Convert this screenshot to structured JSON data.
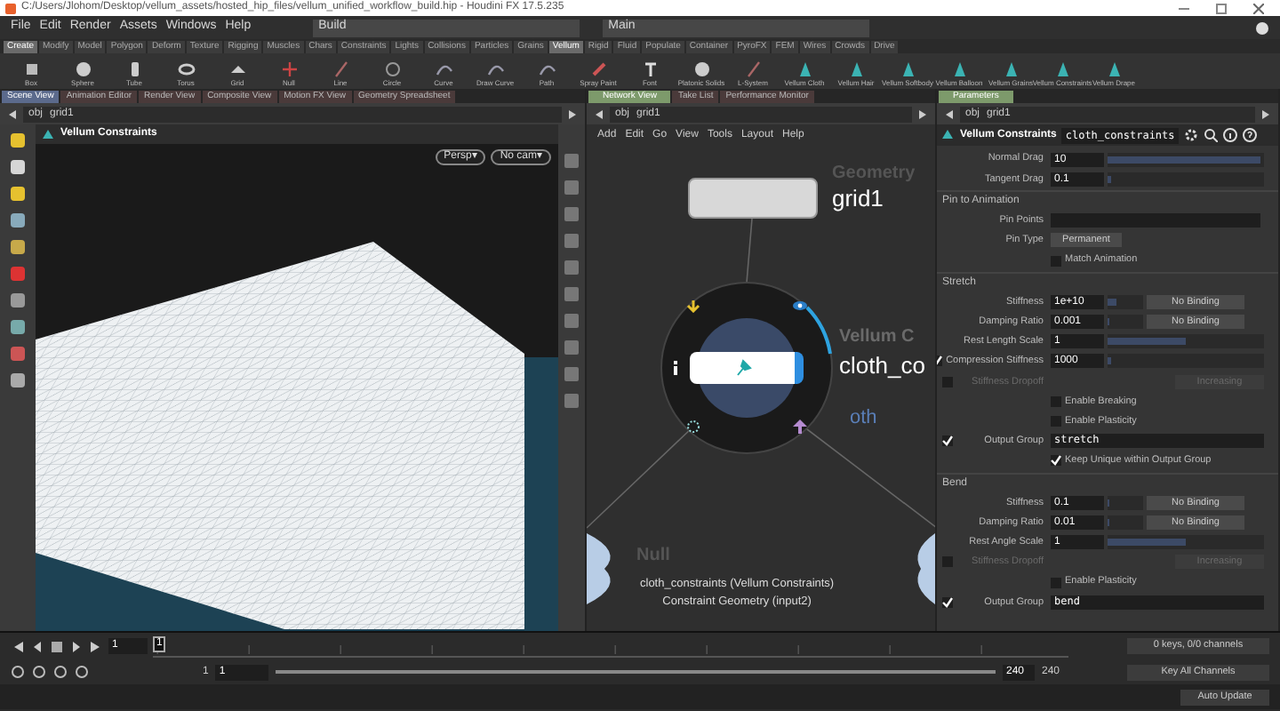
{
  "window": {
    "title": "C:/Users/Jlohom/Desktop/vellum_assets/hosted_hip_files/vellum_unified_workflow_build.hip - Houdini FX 17.5.235"
  },
  "menu": [
    "File",
    "Edit",
    "Render",
    "Assets",
    "Windows",
    "Help"
  ],
  "desktops": [
    "Build",
    "Main"
  ],
  "shelf_tabs": [
    {
      "label": "Create",
      "selected": true
    },
    {
      "label": "Modify",
      "selected": false
    },
    {
      "label": "Model",
      "selected": false
    },
    {
      "label": "Polygon",
      "selected": false
    },
    {
      "label": "Deform",
      "selected": false
    },
    {
      "label": "Texture",
      "selected": false
    },
    {
      "label": "Rigging",
      "selected": false
    },
    {
      "label": "Muscles",
      "selected": false
    },
    {
      "label": "Chars",
      "selected": false
    },
    {
      "label": "Constraints",
      "selected": false
    },
    {
      "label": "Lights",
      "selected": false
    },
    {
      "label": "Collisions",
      "selected": false
    },
    {
      "label": "Particles",
      "selected": false
    },
    {
      "label": "Grains",
      "selected": false
    },
    {
      "label": "Vellum",
      "selected": true
    },
    {
      "label": "Rigid",
      "selected": false
    },
    {
      "label": "Fluid",
      "selected": false
    },
    {
      "label": "Populate",
      "selected": false
    },
    {
      "label": "Container",
      "selected": false
    },
    {
      "label": "PyroFX",
      "selected": false
    },
    {
      "label": "FEM",
      "selected": false
    },
    {
      "label": "Wires",
      "selected": false
    },
    {
      "label": "Crowds",
      "selected": false
    },
    {
      "label": "Drive",
      "selected": false
    }
  ],
  "shelf_tools": [
    {
      "label": "Box",
      "kind": "box"
    },
    {
      "label": "Sphere",
      "kind": "sphere"
    },
    {
      "label": "Tube",
      "kind": "tube"
    },
    {
      "label": "Torus",
      "kind": "torus"
    },
    {
      "label": "Grid",
      "kind": "grid"
    },
    {
      "label": "Null",
      "kind": "null"
    },
    {
      "label": "Line",
      "kind": "line"
    },
    {
      "label": "Circle",
      "kind": "circle"
    },
    {
      "label": "Curve",
      "kind": "curve"
    },
    {
      "label": "Draw Curve",
      "kind": "curve"
    },
    {
      "label": "Path",
      "kind": "curve"
    },
    {
      "label": "Spray Paint",
      "kind": "paint"
    },
    {
      "label": "Font",
      "kind": "font"
    },
    {
      "label": "Platonic Solids",
      "kind": "sphere"
    },
    {
      "label": "L-System",
      "kind": "line"
    },
    {
      "label": "Vellum Cloth",
      "kind": "vellum"
    },
    {
      "label": "Vellum Hair",
      "kind": "vellum"
    },
    {
      "label": "Vellum Softbody",
      "kind": "vellum"
    },
    {
      "label": "Vellum Balloon",
      "kind": "vellum"
    },
    {
      "label": "Vellum Grains",
      "kind": "vellum"
    },
    {
      "label": "Vellum Constraints",
      "kind": "vellum"
    },
    {
      "label": "Vellum Drape",
      "kind": "vellum"
    }
  ],
  "panes": [
    {
      "tabs": [
        {
          "label": "Scene View",
          "selected": true
        },
        {
          "label": "Animation Editor",
          "selected": false
        },
        {
          "label": "Render View",
          "selected": false
        },
        {
          "label": "Composite View",
          "selected": false
        },
        {
          "label": "Motion FX View",
          "selected": false
        },
        {
          "label": "Geometry Spreadsheet",
          "selected": false
        }
      ],
      "path": [
        "obj",
        "grid1"
      ]
    },
    {
      "tabs": [
        {
          "label": "Network View",
          "selected": true
        },
        {
          "label": "Take List",
          "selected": false
        },
        {
          "label": "Performance Monitor",
          "selected": false
        }
      ],
      "path": [
        "obj",
        "grid1"
      ]
    },
    {
      "tabs": [
        {
          "label": "Parameters",
          "selected": true
        }
      ],
      "path": [
        "obj",
        "grid1"
      ]
    }
  ],
  "viewport": {
    "title": "Vellum Constraints",
    "buttons": [
      "Persp▾",
      "No cam▾"
    ]
  },
  "network": {
    "menu": [
      "Add",
      "Edit",
      "Go",
      "View",
      "Tools",
      "Layout",
      "Help"
    ],
    "nodes": [
      {
        "type_label": "Geometry",
        "name": "grid1"
      },
      {
        "type_label": "Vellum C",
        "name": "cloth_co",
        "sublabel": "oth"
      },
      {
        "type_label": "Null"
      }
    ],
    "tooltip": [
      "cloth_constraints (Vellum Constraints)",
      "Constraint Geometry (input2)"
    ]
  },
  "parameters": {
    "node_type": "Vellum Constraints",
    "node_name": "cloth_constraints",
    "rows": [
      {
        "kind": "field",
        "label": "Normal Drag",
        "value": "10",
        "level": 0.98
      },
      {
        "kind": "field",
        "label": "Tangent Drag",
        "value": "0.1",
        "level": 0.02
      },
      {
        "kind": "section",
        "label": "Pin to Animation"
      },
      {
        "kind": "input",
        "label": "Pin Points"
      },
      {
        "kind": "menu",
        "label": "Pin Type",
        "value": "Permanent"
      },
      {
        "kind": "toggle",
        "label": "Match Animation",
        "checked": false
      },
      {
        "kind": "section",
        "label": "Stretch"
      },
      {
        "kind": "field",
        "label": "Stiffness",
        "value": "1e+10",
        "level": 0.25,
        "binding": "No Binding"
      },
      {
        "kind": "field",
        "label": "Damping Ratio",
        "value": "0.001",
        "level": 0.01,
        "binding": "No Binding"
      },
      {
        "kind": "field",
        "label": "Rest Length Scale",
        "value": "1",
        "level": 0.5
      },
      {
        "kind": "field",
        "label": "Compression Stiffness",
        "value": "1000",
        "level": 0.02,
        "checked": true
      },
      {
        "kind": "disabled",
        "label": "Stiffness Dropoff",
        "value": "Increasing",
        "checked": false
      },
      {
        "kind": "toggle",
        "label": "Enable Breaking",
        "checked": false
      },
      {
        "kind": "toggle",
        "label": "Enable Plasticity",
        "checked": false
      },
      {
        "kind": "text",
        "label": "Output Group",
        "value": "stretch",
        "checked": true
      },
      {
        "kind": "toggle",
        "label": "Keep Unique within Output Group",
        "checked": true
      },
      {
        "kind": "section",
        "label": "Bend"
      },
      {
        "kind": "field",
        "label": "Stiffness",
        "value": "0.1",
        "level": 0.02,
        "binding": "No Binding"
      },
      {
        "kind": "field",
        "label": "Damping Ratio",
        "value": "0.01",
        "level": 0.01,
        "binding": "No Binding"
      },
      {
        "kind": "field",
        "label": "Rest Angle Scale",
        "value": "1",
        "level": 0.5
      },
      {
        "kind": "disabled",
        "label": "Stiffness Dropoff",
        "value": "Increasing",
        "checked": false
      },
      {
        "kind": "toggle",
        "label": "Enable Plasticity",
        "checked": false
      },
      {
        "kind": "text",
        "label": "Output Group",
        "value": "bend",
        "checked": true
      }
    ]
  },
  "timeline": {
    "frame": "1",
    "marker_frame": "1",
    "start": "1",
    "range_start": "1",
    "range_end": "240",
    "end": "240",
    "keys": "0 keys, 0/0 channels",
    "key_menu": "Key All Channels",
    "update": "Auto Update"
  }
}
